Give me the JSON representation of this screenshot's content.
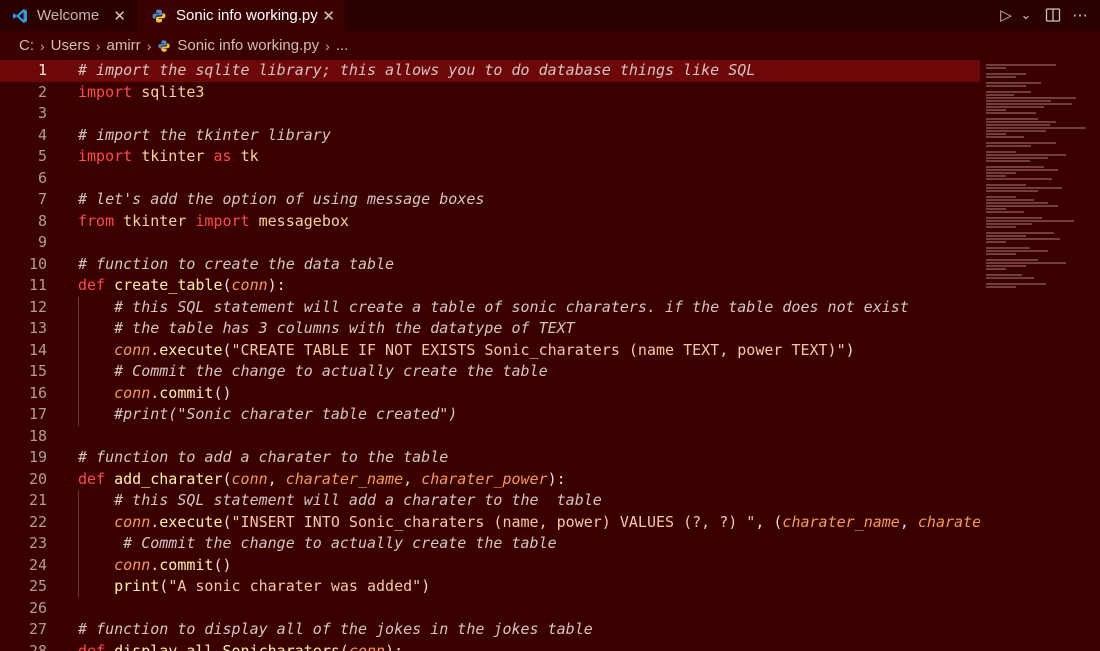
{
  "tabs": [
    {
      "label": "Welcome",
      "icon": "vscode-icon",
      "close": "✕"
    },
    {
      "label": "Sonic info working.py",
      "icon": "python-icon",
      "close": "✕"
    }
  ],
  "toolbar": {
    "run_icon": "▷",
    "dropdown_icon": "⌄",
    "split_icon": "split-editor-icon",
    "more_icon": "⋯"
  },
  "breadcrumb": {
    "items": [
      "C:",
      "Users",
      "amirr",
      "Sonic info working.py",
      "..."
    ],
    "separator": "›"
  },
  "colors": {
    "background": "#3a0000",
    "current_line": "#6e0707",
    "keyword": "#ff4a4a",
    "comment": "#d4c4c4",
    "string": "#f6c7a5",
    "parameter": "#f59a5a",
    "function": "#fff2a8"
  },
  "editor": {
    "current_line": 1,
    "lines": [
      {
        "n": "1",
        "tokens": [
          [
            "c-com",
            "# import the sqlite library; this allows you to do database things like SQL"
          ]
        ]
      },
      {
        "n": "2",
        "tokens": [
          [
            "c-kw",
            "import"
          ],
          [
            "c-txt",
            " "
          ],
          [
            "c-mod",
            "sqlite3"
          ]
        ]
      },
      {
        "n": "3",
        "tokens": []
      },
      {
        "n": "4",
        "tokens": [
          [
            "c-com",
            "# import the tkinter library"
          ]
        ]
      },
      {
        "n": "5",
        "tokens": [
          [
            "c-kw",
            "import"
          ],
          [
            "c-txt",
            " "
          ],
          [
            "c-mod",
            "tkinter"
          ],
          [
            "c-txt",
            " "
          ],
          [
            "c-kw",
            "as"
          ],
          [
            "c-txt",
            " "
          ],
          [
            "c-mod",
            "tk"
          ]
        ]
      },
      {
        "n": "6",
        "tokens": []
      },
      {
        "n": "7",
        "tokens": [
          [
            "c-com",
            "# let's add the option of using message boxes"
          ]
        ]
      },
      {
        "n": "8",
        "tokens": [
          [
            "c-kw",
            "from"
          ],
          [
            "c-txt",
            " "
          ],
          [
            "c-mod",
            "tkinter"
          ],
          [
            "c-txt",
            " "
          ],
          [
            "c-kw",
            "import"
          ],
          [
            "c-txt",
            " "
          ],
          [
            "c-mod",
            "messagebox"
          ]
        ]
      },
      {
        "n": "9",
        "tokens": []
      },
      {
        "n": "10",
        "tokens": [
          [
            "c-com",
            "# function to create the data table"
          ]
        ]
      },
      {
        "n": "11",
        "tokens": [
          [
            "c-kw",
            "def"
          ],
          [
            "c-txt",
            " "
          ],
          [
            "c-fn",
            "create_table"
          ],
          [
            "c-punc",
            "("
          ],
          [
            "c-param",
            "conn"
          ],
          [
            "c-punc",
            "):"
          ]
        ]
      },
      {
        "n": "12",
        "tokens": [
          [
            "c-txt",
            "    "
          ],
          [
            "c-com",
            "# this SQL statement will create a table of sonic charaters. if the table does not exist"
          ]
        ]
      },
      {
        "n": "13",
        "tokens": [
          [
            "c-txt",
            "    "
          ],
          [
            "c-com",
            "# the table has 3 columns with the datatype of TEXT"
          ]
        ]
      },
      {
        "n": "14",
        "tokens": [
          [
            "c-txt",
            "    "
          ],
          [
            "c-param",
            "conn"
          ],
          [
            "c-punc",
            "."
          ],
          [
            "c-fn",
            "execute"
          ],
          [
            "c-punc",
            "("
          ],
          [
            "c-str",
            "\"CREATE TABLE IF NOT EXISTS Sonic_charaters (name TEXT, power TEXT)\""
          ],
          [
            "c-punc",
            ")"
          ]
        ]
      },
      {
        "n": "15",
        "tokens": [
          [
            "c-txt",
            "    "
          ],
          [
            "c-com",
            "# Commit the change to actually create the table"
          ]
        ]
      },
      {
        "n": "16",
        "tokens": [
          [
            "c-txt",
            "    "
          ],
          [
            "c-param",
            "conn"
          ],
          [
            "c-punc",
            "."
          ],
          [
            "c-fn",
            "commit"
          ],
          [
            "c-punc",
            "()"
          ]
        ]
      },
      {
        "n": "17",
        "tokens": [
          [
            "c-txt",
            "    "
          ],
          [
            "c-com",
            "#print(\"Sonic charater table created\")"
          ]
        ]
      },
      {
        "n": "18",
        "tokens": []
      },
      {
        "n": "19",
        "tokens": [
          [
            "c-com",
            "# function to add a charater to the table"
          ]
        ]
      },
      {
        "n": "20",
        "tokens": [
          [
            "c-kw",
            "def"
          ],
          [
            "c-txt",
            " "
          ],
          [
            "c-fn",
            "add_charater"
          ],
          [
            "c-punc",
            "("
          ],
          [
            "c-param",
            "conn"
          ],
          [
            "c-punc",
            ", "
          ],
          [
            "c-param",
            "charater_name"
          ],
          [
            "c-punc",
            ", "
          ],
          [
            "c-param",
            "charater_power"
          ],
          [
            "c-punc",
            "):"
          ]
        ]
      },
      {
        "n": "21",
        "tokens": [
          [
            "c-txt",
            "    "
          ],
          [
            "c-com",
            "# this SQL statement will add a charater to the  table"
          ]
        ]
      },
      {
        "n": "22",
        "tokens": [
          [
            "c-txt",
            "    "
          ],
          [
            "c-param",
            "conn"
          ],
          [
            "c-punc",
            "."
          ],
          [
            "c-fn",
            "execute"
          ],
          [
            "c-punc",
            "("
          ],
          [
            "c-str",
            "\"INSERT INTO Sonic_charaters (name, power) VALUES (?, ?) \""
          ],
          [
            "c-punc",
            ", ("
          ],
          [
            "c-param",
            "charater_name"
          ],
          [
            "c-punc",
            ", "
          ],
          [
            "c-param",
            "charater_power"
          ],
          [
            "c-punc",
            "))"
          ]
        ]
      },
      {
        "n": "23",
        "tokens": [
          [
            "c-txt",
            "     "
          ],
          [
            "c-com",
            "# Commit the change to actually create the table"
          ]
        ]
      },
      {
        "n": "24",
        "tokens": [
          [
            "c-txt",
            "    "
          ],
          [
            "c-param",
            "conn"
          ],
          [
            "c-punc",
            "."
          ],
          [
            "c-fn",
            "commit"
          ],
          [
            "c-punc",
            "()"
          ]
        ]
      },
      {
        "n": "25",
        "tokens": [
          [
            "c-txt",
            "    "
          ],
          [
            "c-fn",
            "print"
          ],
          [
            "c-punc",
            "("
          ],
          [
            "c-str",
            "\"A sonic charater was added\""
          ],
          [
            "c-punc",
            ")"
          ]
        ]
      },
      {
        "n": "26",
        "tokens": []
      },
      {
        "n": "27",
        "tokens": [
          [
            "c-com",
            "# function to display all of the jokes in the jokes table"
          ]
        ]
      },
      {
        "n": "28",
        "tokens": [
          [
            "c-kw",
            "def"
          ],
          [
            "c-txt",
            " "
          ],
          [
            "c-fn",
            "display_all_Sonicharaters"
          ],
          [
            "c-punc",
            "("
          ],
          [
            "c-param",
            "conn"
          ],
          [
            "c-punc",
            "):"
          ]
        ]
      }
    ]
  }
}
